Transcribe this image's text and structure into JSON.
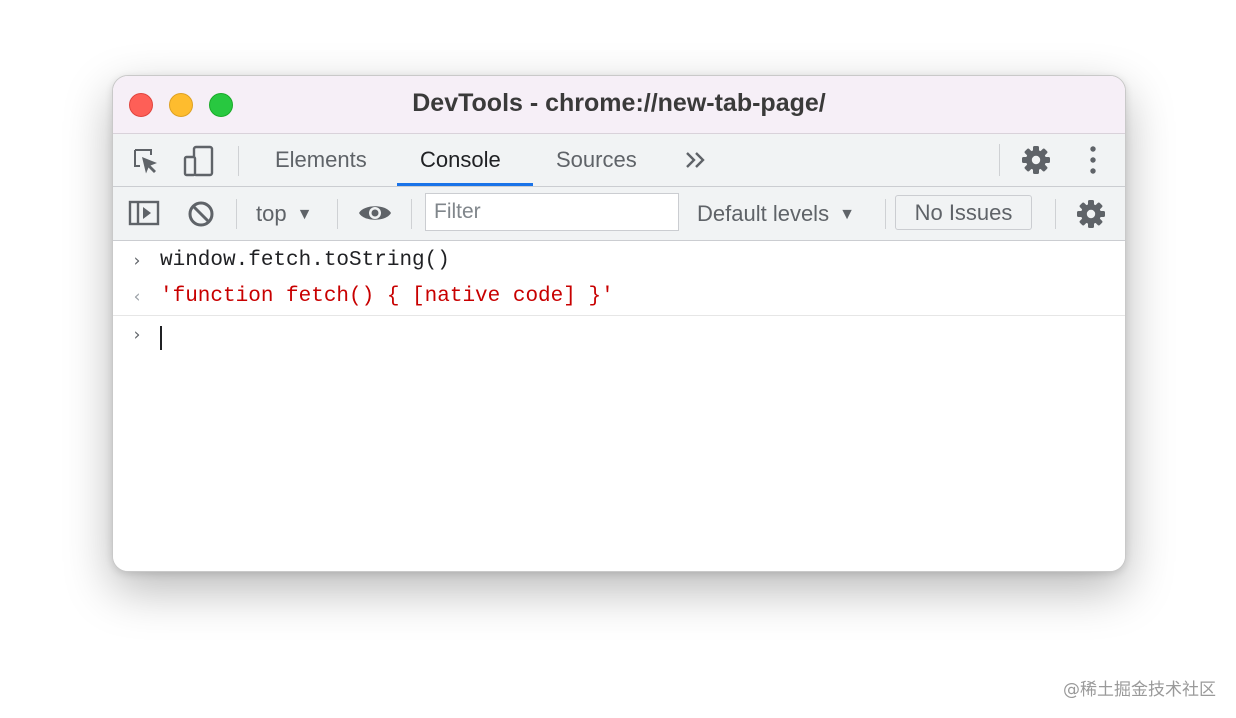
{
  "window": {
    "title": "DevTools - chrome://new-tab-page/"
  },
  "tabs": [
    {
      "label": "Elements",
      "active": false
    },
    {
      "label": "Console",
      "active": true
    },
    {
      "label": "Sources",
      "active": false
    }
  ],
  "tabbar": {
    "more_tabs_icon": "chevrons-right-icon",
    "inspect_icon": "inspect-element-icon",
    "device_icon": "device-toolbar-icon",
    "settings_icon": "gear-icon",
    "menu_icon": "vertical-ellipsis-icon"
  },
  "toolbar": {
    "context": "top",
    "filter_placeholder": "Filter",
    "filter_value": "",
    "levels": "Default levels",
    "issues": "No Issues"
  },
  "console": {
    "input": "window.fetch.toString()",
    "output": "'function fetch() { [native code] }'",
    "prompt_value": ""
  },
  "watermark": "@稀土掘金技术社区",
  "colors": {
    "accent": "#1a73e8",
    "output_string": "#c80000",
    "titlebar": "#f6eff7",
    "toolbar": "#f1f3f4"
  }
}
